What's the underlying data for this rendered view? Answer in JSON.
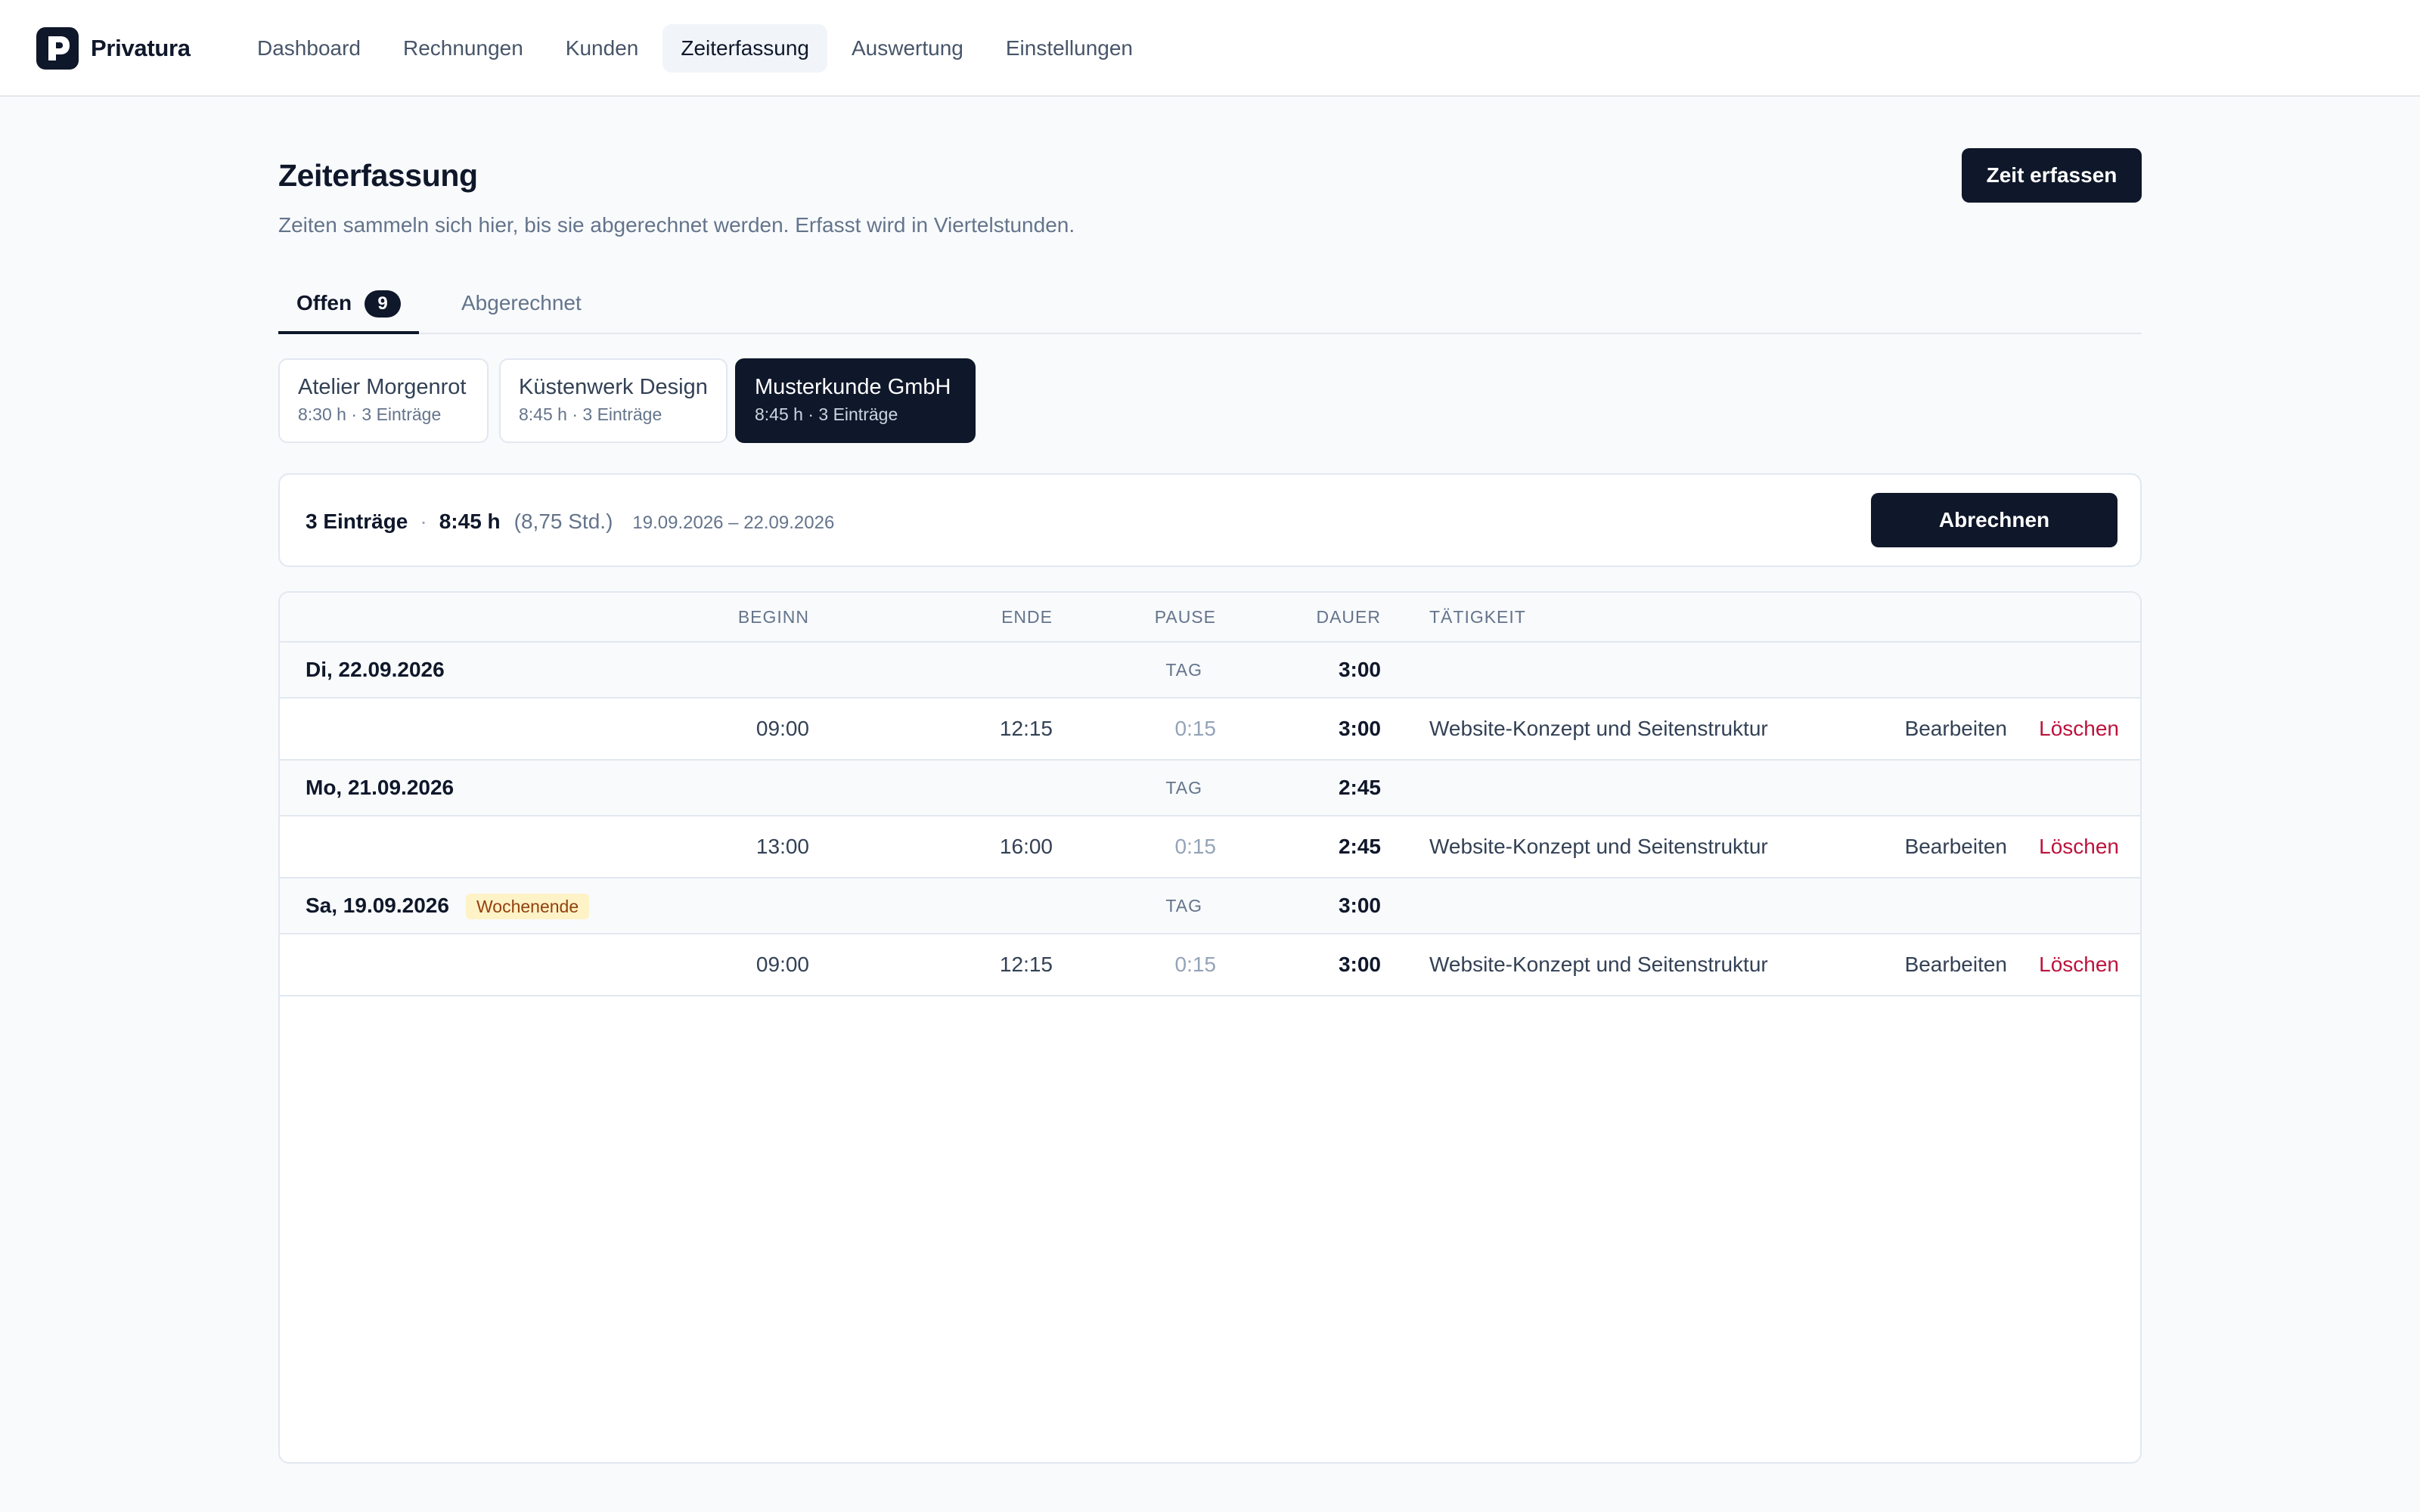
{
  "app": {
    "name": "Privatura"
  },
  "nav": {
    "items": [
      {
        "label": "Dashboard"
      },
      {
        "label": "Rechnungen"
      },
      {
        "label": "Kunden"
      },
      {
        "label": "Zeiterfassung",
        "active": true
      },
      {
        "label": "Auswertung"
      },
      {
        "label": "Einstellungen"
      }
    ]
  },
  "header": {
    "title": "Zeiterfassung",
    "subtitle": "Zeiten sammeln sich hier, bis sie abgerechnet werden. Erfasst wird in Viertelstunden.",
    "add_button": "Zeit erfassen"
  },
  "tabs": {
    "open_label": "Offen",
    "open_count": "9",
    "billed_label": "Abgerechnet"
  },
  "clients": [
    {
      "name": "Atelier Morgenrot",
      "meta": "8:30 h · 3 Einträge"
    },
    {
      "name": "Küstenwerk Design",
      "meta": "8:45 h · 3 Einträge"
    },
    {
      "name": "Musterkunde GmbH",
      "meta": "8:45 h · 3 Einträge",
      "active": true
    }
  ],
  "summary": {
    "count": "3 Einträge",
    "separator": "·",
    "hours": "8:45 h",
    "decimal": "(8,75 Std.)",
    "range": "19.09.2026 – 22.09.2026",
    "bill_button": "Abrechnen"
  },
  "table": {
    "headers": {
      "begin": "BEGINN",
      "end": "ENDE",
      "pause": "PAUSE",
      "duration": "DAUER",
      "activity": "TÄTIGKEIT"
    },
    "days": [
      {
        "date": "Di, 22.09.2026",
        "tag": "TAG",
        "total": "3:00",
        "entry": {
          "begin": "09:00",
          "end": "12:15",
          "pause": "0:15",
          "duration": "3:00",
          "activity": "Website-Konzept und Seitenstruktur",
          "edit": "Bearbeiten",
          "delete": "Löschen"
        }
      },
      {
        "date": "Mo, 21.09.2026",
        "tag": "TAG",
        "total": "2:45",
        "entry": {
          "begin": "13:00",
          "end": "16:00",
          "pause": "0:15",
          "duration": "2:45",
          "activity": "Website-Konzept und Seitenstruktur",
          "edit": "Bearbeiten",
          "delete": "Löschen"
        }
      },
      {
        "date": "Sa, 19.09.2026",
        "badge": "Wochenende",
        "tag": "TAG",
        "total": "3:00",
        "entry": {
          "begin": "09:00",
          "end": "12:15",
          "pause": "0:15",
          "duration": "3:00",
          "activity": "Website-Konzept und Seitenstruktur",
          "edit": "Bearbeiten",
          "delete": "Löschen"
        }
      }
    ]
  },
  "colors": {
    "primary": "#0f172a",
    "delete": "#be123c",
    "weekend_bg": "#fef3c7",
    "weekend_text": "#92400e"
  }
}
